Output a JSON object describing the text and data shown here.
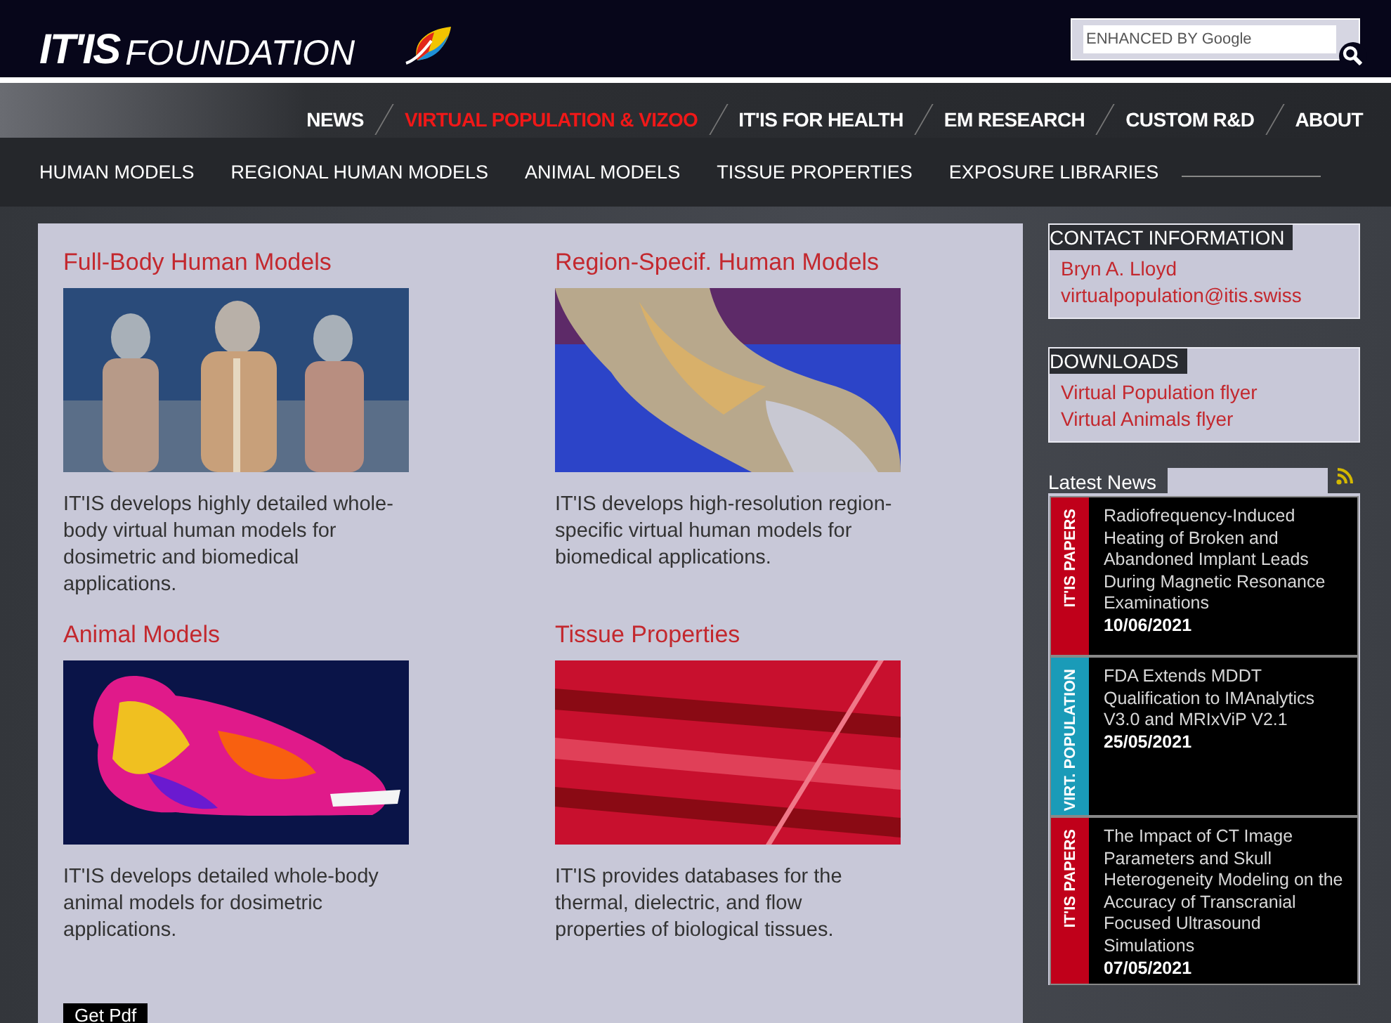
{
  "header": {
    "logo": "IT'IS",
    "logo_word": "FOUNDATION",
    "search": {
      "placeholder": "ENHANCED BY Google"
    }
  },
  "nav": [
    {
      "label": "NEWS",
      "selected": false
    },
    {
      "label": "VIRTUAL POPULATION & VIZOO",
      "selected": true
    },
    {
      "label": "IT'IS FOR HEALTH",
      "selected": false
    },
    {
      "label": "EM RESEARCH",
      "selected": false
    },
    {
      "label": "CUSTOM R&D",
      "selected": false
    },
    {
      "label": "ABOUT",
      "selected": false
    }
  ],
  "subnav": [
    "HUMAN MODELS",
    "REGIONAL HUMAN MODELS",
    "ANIMAL MODELS",
    "TISSUE PROPERTIES",
    "EXPOSURE LIBRARIES"
  ],
  "cards": [
    {
      "title": "Full-Body Human Models",
      "text": "IT'IS develops highly detailed whole-body virtual human models for dosimetric and biomedical applications."
    },
    {
      "title": "Region-Specif. Human Models",
      "text": "IT'IS develops high-resolution region-specific virtual human models for biomedical applications."
    },
    {
      "title": "Animal Models",
      "text": "IT'IS develops detailed whole-body animal models for dosimetric applications."
    },
    {
      "title": "Tissue Properties",
      "text": "IT'IS provides databases for the thermal, dielectric, and flow properties of biological tissues."
    }
  ],
  "pdf_button": "Get Pdf",
  "contact": {
    "heading": "CONTACT INFORMATION",
    "name": "Bryn A. Lloyd",
    "email": "virtualpopulation@itis.swiss"
  },
  "downloads": {
    "heading": "DOWNLOADS",
    "links": [
      "Virtual Population flyer",
      "Virtual Animals flyer"
    ]
  },
  "news": {
    "heading": "Latest News",
    "items": [
      {
        "category": "IT'IS PAPERS",
        "color": "#c0001a",
        "title": "Radiofrequency-Induced Heating of Broken and Abandoned Implant Leads During Magnetic Resonance Examinations",
        "date": "10/06/2021"
      },
      {
        "category": "VIRT. POPULATION",
        "color": "#1a9bb8",
        "title": "FDA Extends MDDT Qualification to IMAnalytics V3.0 and MRIxViP V2.1",
        "date": "25/05/2021"
      },
      {
        "category": "IT'IS PAPERS",
        "color": "#c0001a",
        "title": "The Impact of CT Image Parameters and Skull Heterogeneity Modeling on the Accuracy of Transcranial Focused Ultrasound Simulations",
        "date": "07/05/2021"
      }
    ]
  }
}
